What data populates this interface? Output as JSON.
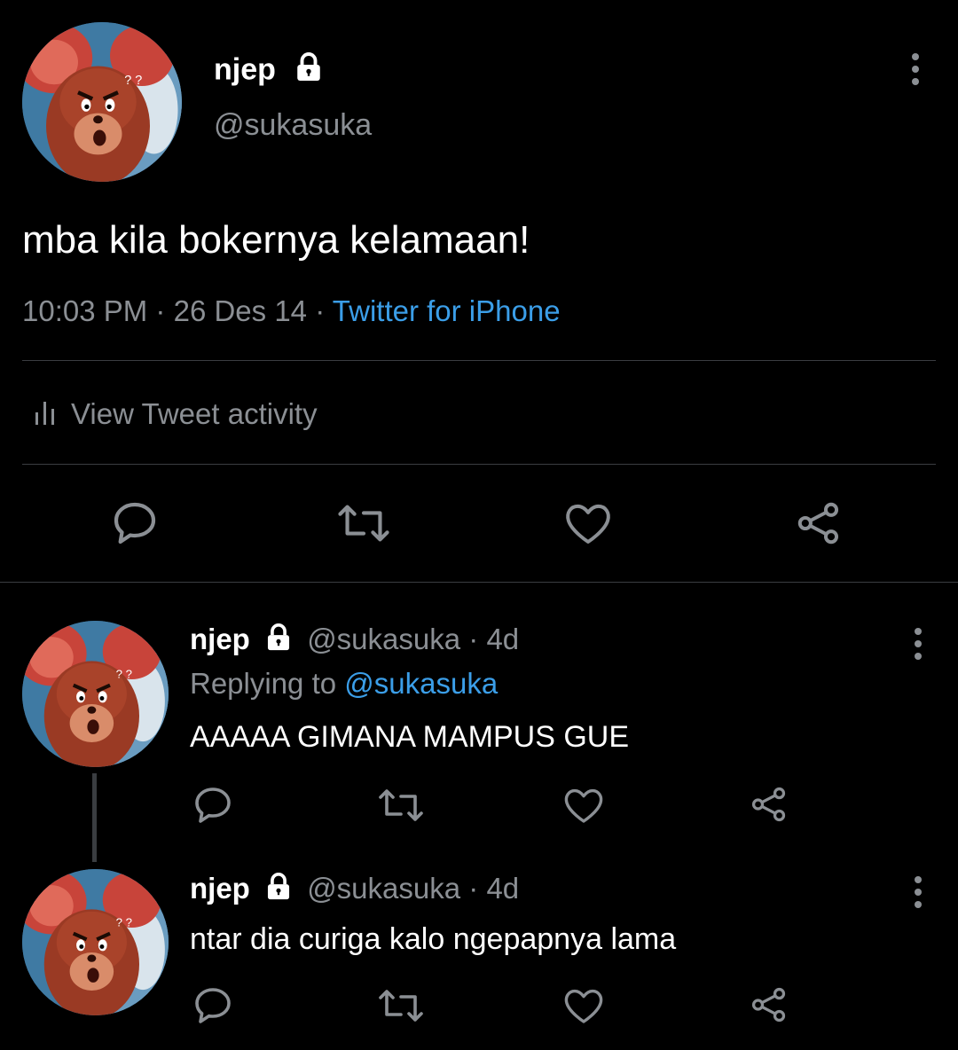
{
  "main_tweet": {
    "display_name": "njep",
    "handle": "@sukasuka",
    "text": "mba kila bokernya kelamaan!",
    "time": "10:03 PM",
    "date": "26 Des 14",
    "source": "Twitter for iPhone",
    "activity_label": "View Tweet activity"
  },
  "replies": [
    {
      "display_name": "njep",
      "handle": "@sukasuka",
      "age": "4d",
      "replying_label": "Replying to",
      "replying_to": "@sukasuka",
      "text": "AAAAA GIMANA MAMPUS GUE"
    },
    {
      "display_name": "njep",
      "handle": "@sukasuka",
      "age": "4d",
      "text": "ntar dia curiga kalo ngepapnya lama"
    }
  ],
  "separator": "·",
  "icons": {
    "lock": "lock-icon",
    "more": "more-vertical-icon",
    "reply": "reply-icon",
    "retweet": "retweet-icon",
    "like": "heart-icon",
    "share": "share-icon",
    "activity": "bar-chart-icon"
  },
  "colors": {
    "background": "#000000",
    "text": "#e7e9ea",
    "muted": "#8b8f94",
    "link": "#3b9ee8",
    "divider": "#3a3d41"
  }
}
